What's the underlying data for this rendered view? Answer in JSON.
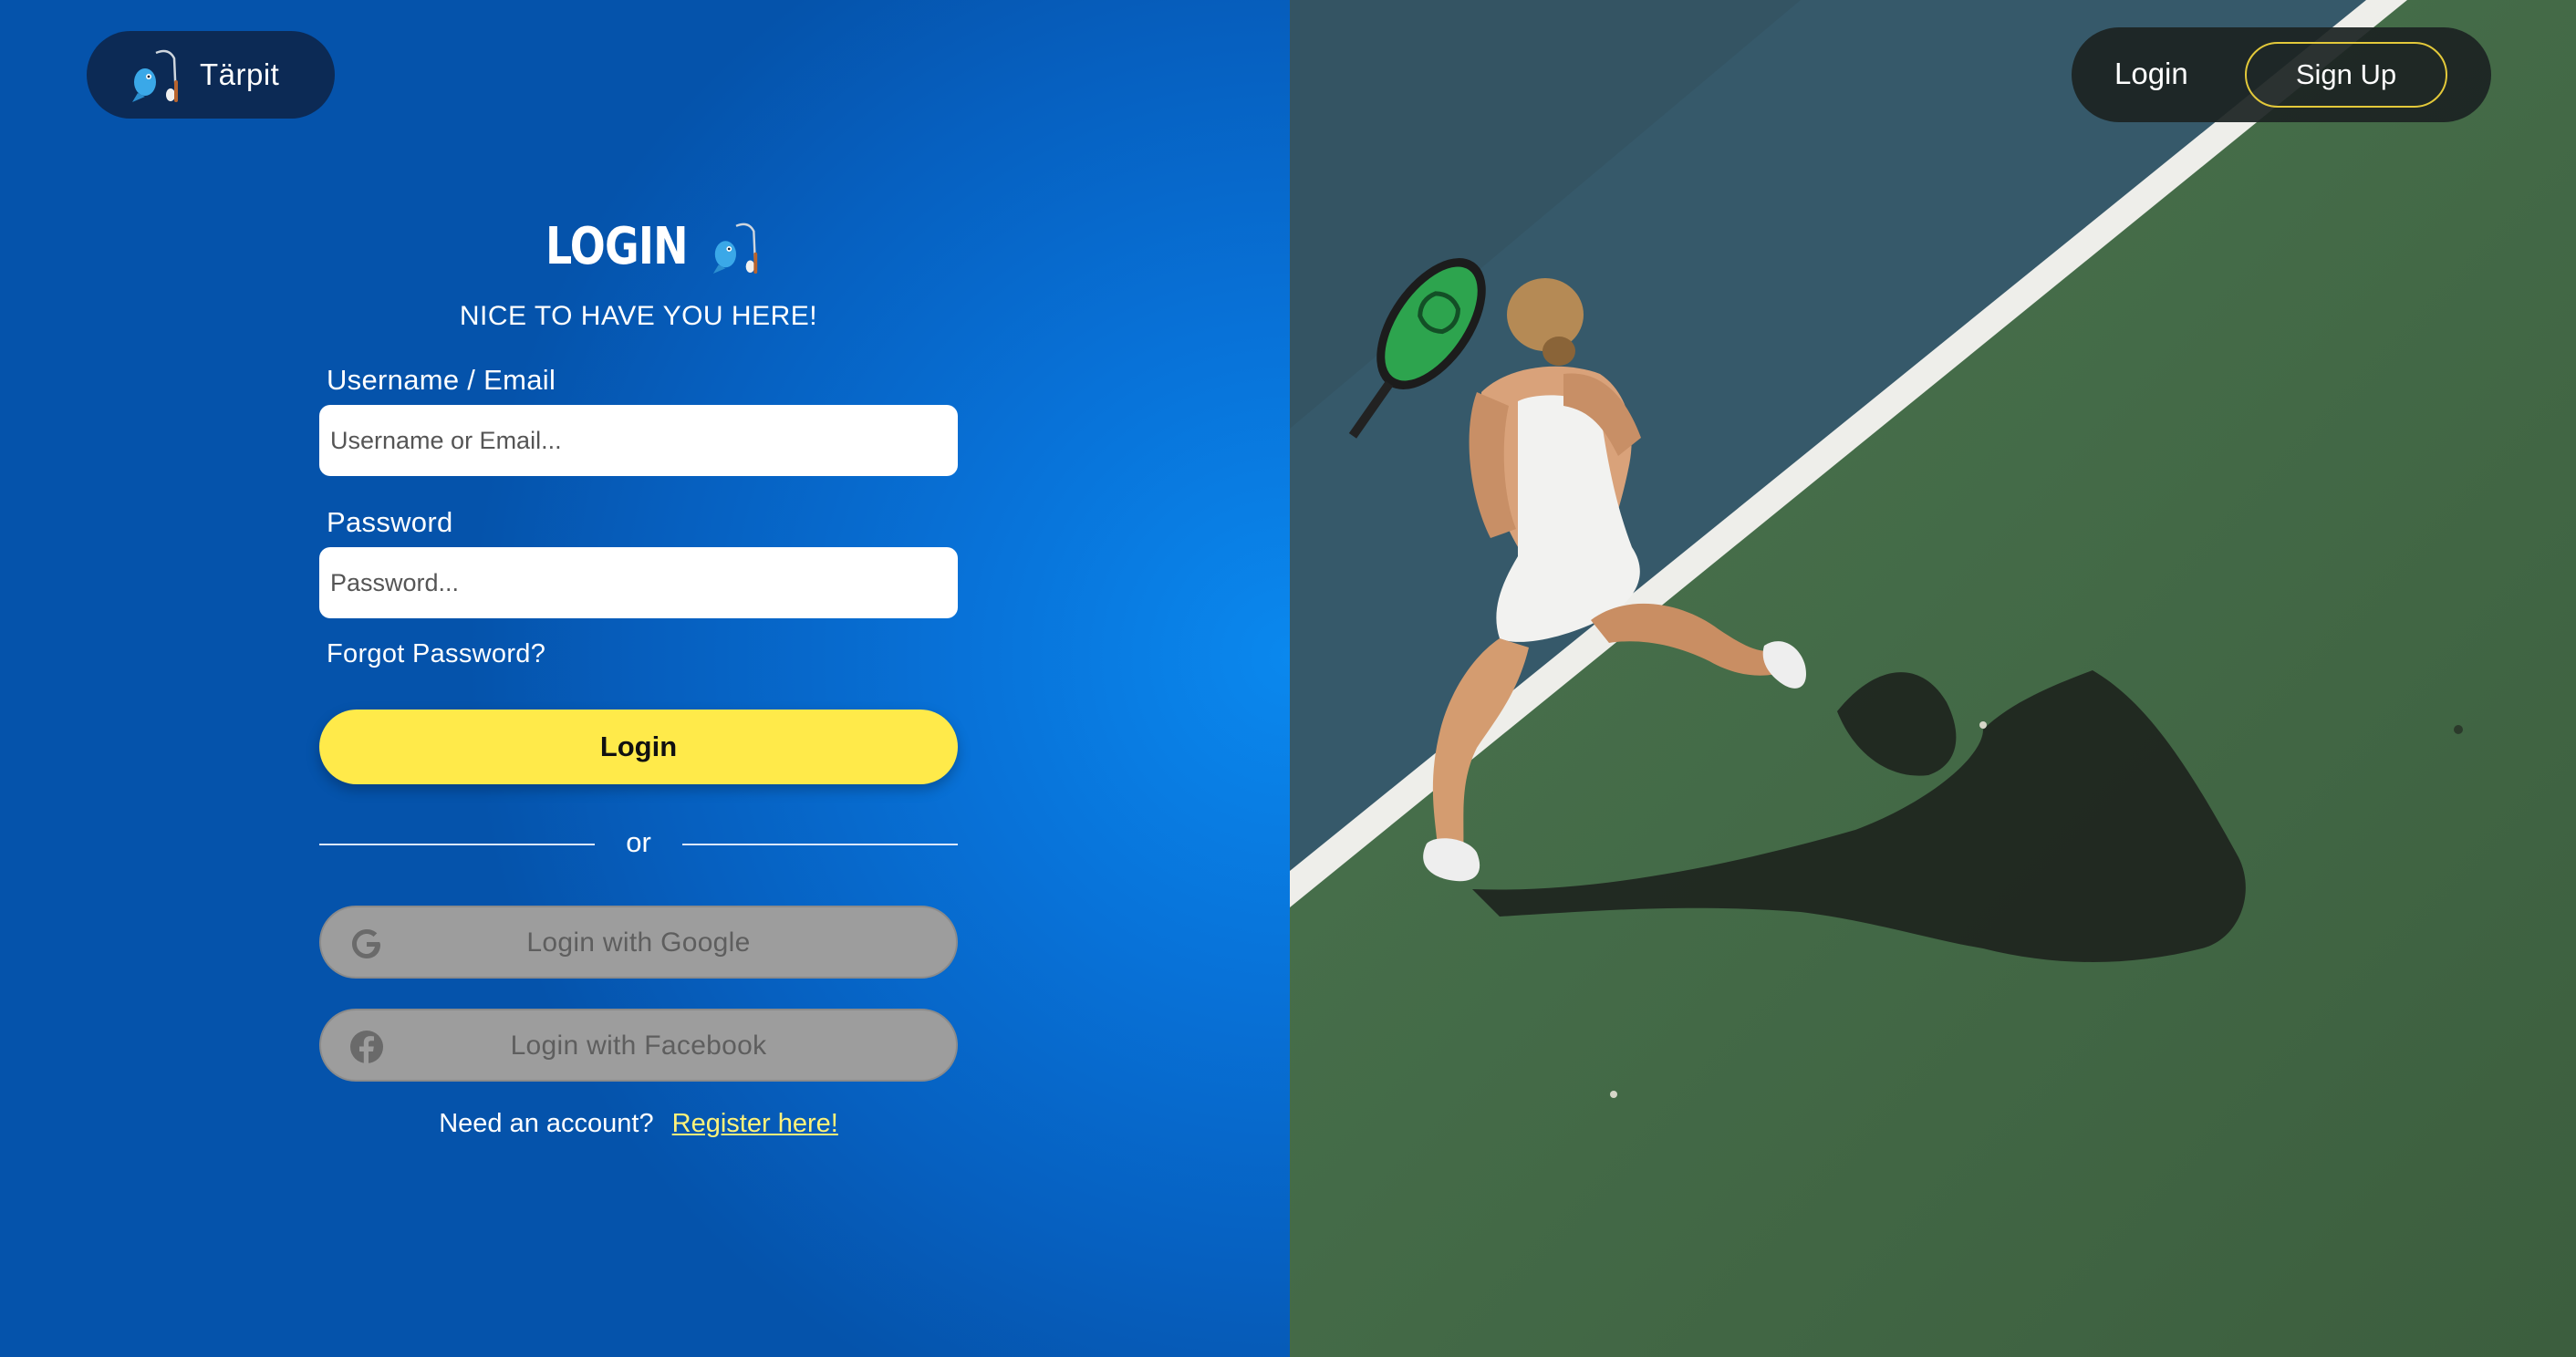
{
  "brand": {
    "name": "Tärpit",
    "logo_icon": "fishing-rod-fish-icon"
  },
  "nav": {
    "login_label": "Login",
    "signup_label": "Sign Up"
  },
  "form": {
    "title": "LOGIN",
    "subtitle": "NICE TO HAVE YOU HERE!",
    "username_label": "Username / Email",
    "username_placeholder": "Username or Email...",
    "username_value": "",
    "password_label": "Password",
    "password_placeholder": "Password...",
    "password_value": "",
    "forgot_label": "Forgot Password?",
    "submit_label": "Login",
    "divider_text": "or",
    "google_label": "Login with Google",
    "google_icon": "google-icon",
    "facebook_label": "Login with Facebook",
    "facebook_icon": "facebook-icon",
    "register_prompt": "Need an account?",
    "register_link": "Register here!"
  },
  "colors": {
    "panel_blue": "#0a72d8",
    "brand_pill": "#0c2a55",
    "login_button": "#ffea4a",
    "social_button": "#9d9d9d",
    "register_link": "#fff27a",
    "signup_border": "#e3c93a",
    "court_green": "#446b46",
    "court_blue": "#36596a"
  }
}
